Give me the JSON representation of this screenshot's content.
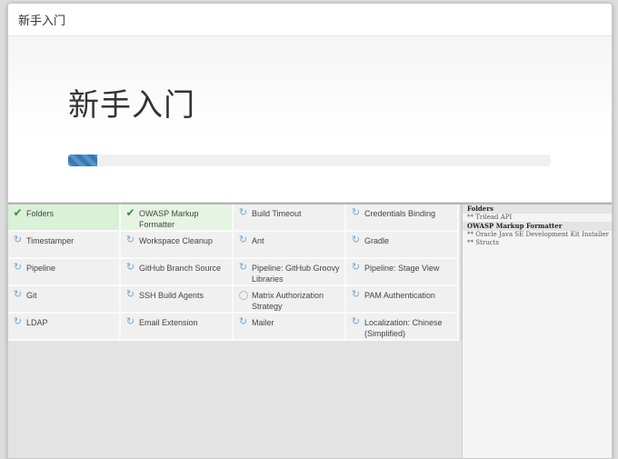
{
  "dialog": {
    "header_title": "新手入门",
    "hero_title": "新手入门",
    "progress_percent": 6
  },
  "plugins": [
    {
      "name": "Folders",
      "status": "installed"
    },
    {
      "name": "OWASP Markup Formatter",
      "status": "installed"
    },
    {
      "name": "Build Timeout",
      "status": "pending"
    },
    {
      "name": "Credentials Binding",
      "status": "pending"
    },
    {
      "name": "Timestamper",
      "status": "pending"
    },
    {
      "name": "Workspace Cleanup",
      "status": "pending"
    },
    {
      "name": "Ant",
      "status": "pending"
    },
    {
      "name": "Gradle",
      "status": "pending"
    },
    {
      "name": "Pipeline",
      "status": "pending"
    },
    {
      "name": "GitHub Branch Source",
      "status": "pending"
    },
    {
      "name": "Pipeline: GitHub Groovy Libraries",
      "status": "pending"
    },
    {
      "name": "Pipeline: Stage View",
      "status": "pending"
    },
    {
      "name": "Git",
      "status": "pending"
    },
    {
      "name": "SSH Build Agents",
      "status": "pending"
    },
    {
      "name": "Matrix Authorization Strategy",
      "status": "waiting"
    },
    {
      "name": "PAM Authentication",
      "status": "pending"
    },
    {
      "name": "LDAP",
      "status": "pending"
    },
    {
      "name": "Email Extension",
      "status": "pending"
    },
    {
      "name": "Mailer",
      "status": "pending"
    },
    {
      "name": "Localization: Chinese (Simplified)",
      "status": "pending"
    }
  ],
  "install_log": [
    {
      "text": "Folders",
      "highlight": true
    },
    {
      "text": "** Trilead API",
      "highlight": false
    },
    {
      "text": "OWASP Markup Formatter",
      "highlight": true
    },
    {
      "text": "** Oracle Java SE Development Kit Installer",
      "highlight": false
    },
    {
      "text": "** Structs",
      "highlight": false
    }
  ],
  "colors": {
    "installed_tile": "#d9f1d6",
    "pending_tile": "#f0f0f0",
    "progress": "#337ab7",
    "check_icon": "#3c8a3c",
    "refresh_icon": "#7da7c9"
  },
  "icons": {
    "installed": "check-icon",
    "pending": "refresh-icon",
    "waiting": "circle-icon"
  }
}
